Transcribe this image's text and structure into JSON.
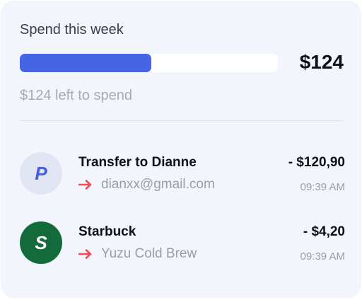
{
  "widget": {
    "title": "Spend this week",
    "amount": "$124",
    "remaining_text": "$124 left to spend",
    "progress_fraction": 0.51,
    "progress_color": "#4565e6"
  },
  "transactions": [
    {
      "name": "Transfer to Dianne",
      "detail": "dianxx@gmail.com",
      "amount": "- $120,90",
      "time": "09:39 AM",
      "avatar_letter": "P",
      "avatar_icon": "paypal-icon",
      "avatar_bg": "#e1e4f3",
      "avatar_fg": "#3f5fe0"
    },
    {
      "name": "Starbuck",
      "detail": "Yuzu Cold Brew",
      "amount": "- $4,20",
      "time": "09:39 AM",
      "avatar_letter": "S",
      "avatar_icon": "starbucks-icon",
      "avatar_bg": "#136b3c",
      "avatar_fg": "#ffffff"
    }
  ],
  "arrow_color": "#f24a58"
}
